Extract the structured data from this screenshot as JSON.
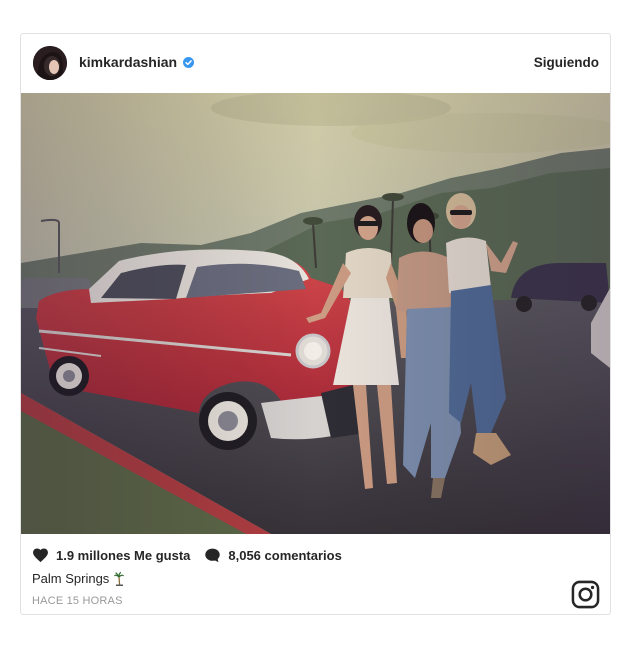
{
  "post": {
    "username": "kimkardashian",
    "follow_label": "Siguiendo",
    "likes_text": "1.9 millones Me gusta",
    "comments_text": "8,056 comentarios",
    "caption": "Palm Springs",
    "time_ago": "HACE 15 HORAS"
  },
  "colors": {
    "verified": "#3897f0",
    "text": "#262626",
    "muted": "#999999",
    "car_red": "#c8323c"
  },
  "icons": {
    "verified": "verified-badge-icon",
    "likes": "heart-icon",
    "comments": "comment-icon",
    "caption_emoji": "palm-tree-icon",
    "brand": "instagram-icon"
  }
}
